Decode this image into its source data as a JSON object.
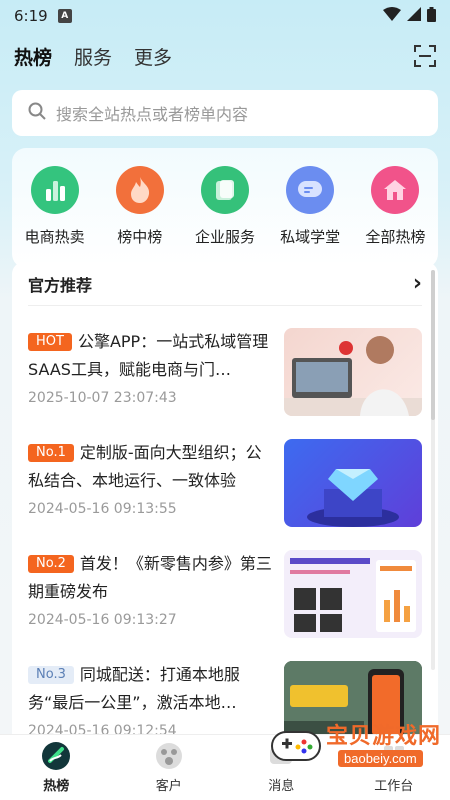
{
  "status_bar": {
    "time": "6:19",
    "notification_glyph": "A"
  },
  "top_tabs": [
    {
      "label": "热榜",
      "active": true
    },
    {
      "label": "服务",
      "active": false
    },
    {
      "label": "更多",
      "active": false
    }
  ],
  "search": {
    "placeholder": "搜索全站热点或者榜单内容"
  },
  "categories": [
    {
      "label": "电商热卖",
      "icon": "bar-chart-icon",
      "color": "#34c47e"
    },
    {
      "label": "榜中榜",
      "icon": "flame-icon",
      "color": "#f2703b"
    },
    {
      "label": "企业服务",
      "icon": "document-icon",
      "color": "#35c17a"
    },
    {
      "label": "私域学堂",
      "icon": "chat-bubble-icon",
      "color": "#6b8df0"
    },
    {
      "label": "全部热榜",
      "icon": "home-icon",
      "color": "#f1538a"
    }
  ],
  "section": {
    "title": "官方推荐",
    "more_glyph": "›"
  },
  "news": [
    {
      "badge": "HOT",
      "title": "公擎APP：一站式私域管理SAAS工具，赋能电商与门…",
      "date": "2025-10-07 23:07:43"
    },
    {
      "badge": "No.1",
      "title": "定制版-面向大型组织；公私结合、本地运行、一致体验",
      "date": "2024-05-16 09:13:55"
    },
    {
      "badge": "No.2",
      "title": "首发！《新零售内参》第三期重磅发布",
      "date": "2024-05-16 09:13:27"
    },
    {
      "badge": "No.3",
      "title": "同城配送：打通本地服务“最后一公里”，激活本地…",
      "date": "2024-05-16 09:12:54"
    }
  ],
  "bottom_nav": [
    {
      "label": "热榜",
      "active": true
    },
    {
      "label": "客户",
      "active": false
    },
    {
      "label": "消息",
      "active": false
    },
    {
      "label": "工作台",
      "active": false
    }
  ],
  "watermark": {
    "title": "宝贝游戏网",
    "url": "baobeiy.com"
  },
  "colors": {
    "accent": "#f4651f",
    "badge_light": "#e4ecf7"
  }
}
